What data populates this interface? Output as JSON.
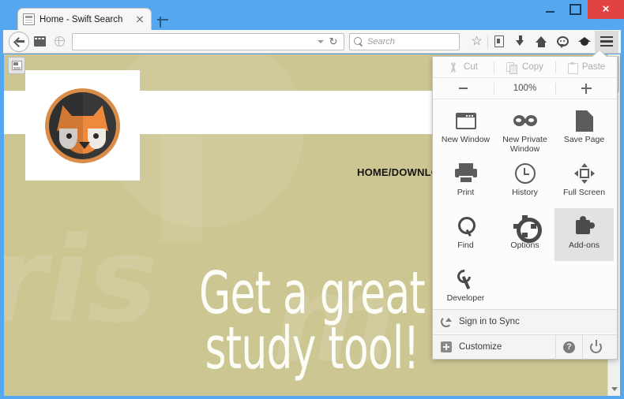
{
  "window": {
    "controls": {
      "minimize": "minimize-button",
      "maximize": "maximize-button",
      "close_label": "×"
    }
  },
  "tabstrip": {
    "tabs": [
      {
        "title": "Home - Swift Search",
        "favicon": "page-icon",
        "close": "×"
      }
    ],
    "new_tab_label": "+"
  },
  "toolbar": {
    "back_icon": "back-arrow-icon",
    "forward_icon": "forward-icon",
    "globe_icon": "globe-icon",
    "url_value": "",
    "url_placeholder": "",
    "url_dropdown_icon": "chevron-down-icon",
    "reload_label": "↻",
    "search_placeholder": "Search",
    "search_icon": "search-icon",
    "buttons": [
      {
        "name": "bookmark-star-button",
        "icon": "star-icon",
        "glyph": "☆"
      },
      {
        "name": "library-button",
        "icon": "library-icon"
      },
      {
        "name": "downloads-button",
        "icon": "download-arrow-icon"
      },
      {
        "name": "home-button",
        "icon": "home-icon"
      },
      {
        "name": "chat-button",
        "icon": "chat-bubble-icon"
      },
      {
        "name": "graduation-cap-extension-button",
        "icon": "graduation-cap-icon"
      }
    ],
    "menu_button_icon": "hamburger-menu-icon"
  },
  "menu": {
    "edit_row": [
      {
        "label": "Cut",
        "icon": "cut-icon",
        "enabled": false
      },
      {
        "label": "Copy",
        "icon": "copy-icon",
        "enabled": false
      },
      {
        "label": "Paste",
        "icon": "paste-icon",
        "enabled": false
      }
    ],
    "zoom": {
      "minus_label": "−",
      "level": "100%",
      "plus_label": "+"
    },
    "grid": [
      {
        "label": "New Window",
        "icon": "new-window-icon",
        "active": false
      },
      {
        "label": "New Private Window",
        "icon": "private-mask-icon",
        "active": false
      },
      {
        "label": "Save Page",
        "icon": "save-page-icon",
        "active": false
      },
      {
        "label": "Print",
        "icon": "print-icon",
        "active": false
      },
      {
        "label": "History",
        "icon": "clock-icon",
        "active": false
      },
      {
        "label": "Full Screen",
        "icon": "full-screen-icon",
        "active": false
      },
      {
        "label": "Find",
        "icon": "magnifier-icon",
        "active": false
      },
      {
        "label": "Options",
        "icon": "gear-icon",
        "active": false
      },
      {
        "label": "Add-ons",
        "icon": "puzzle-piece-icon",
        "active": true
      },
      {
        "label": "Developer",
        "icon": "wrench-icon",
        "active": false
      }
    ],
    "footer": {
      "sync_label": "Sign in to Sync",
      "sync_icon": "sync-icon",
      "customize_label": "Customize",
      "customize_icon": "plus-box-icon",
      "help_label": "?",
      "help_icon": "help-icon",
      "power_icon": "power-icon"
    }
  },
  "page": {
    "background_color": "#ccc693",
    "logo_alt": "fox-logo",
    "nav_text": "HOME/DOWNLOA",
    "headline_line1": "Get a great",
    "headline_line2": "study tool!",
    "watermark_left": "ris",
    "watermark_right": "m",
    "corner_button_icon": "page-thumbnail-icon"
  },
  "scrollbar": {
    "down_arrow_icon": "chevron-down-icon"
  }
}
